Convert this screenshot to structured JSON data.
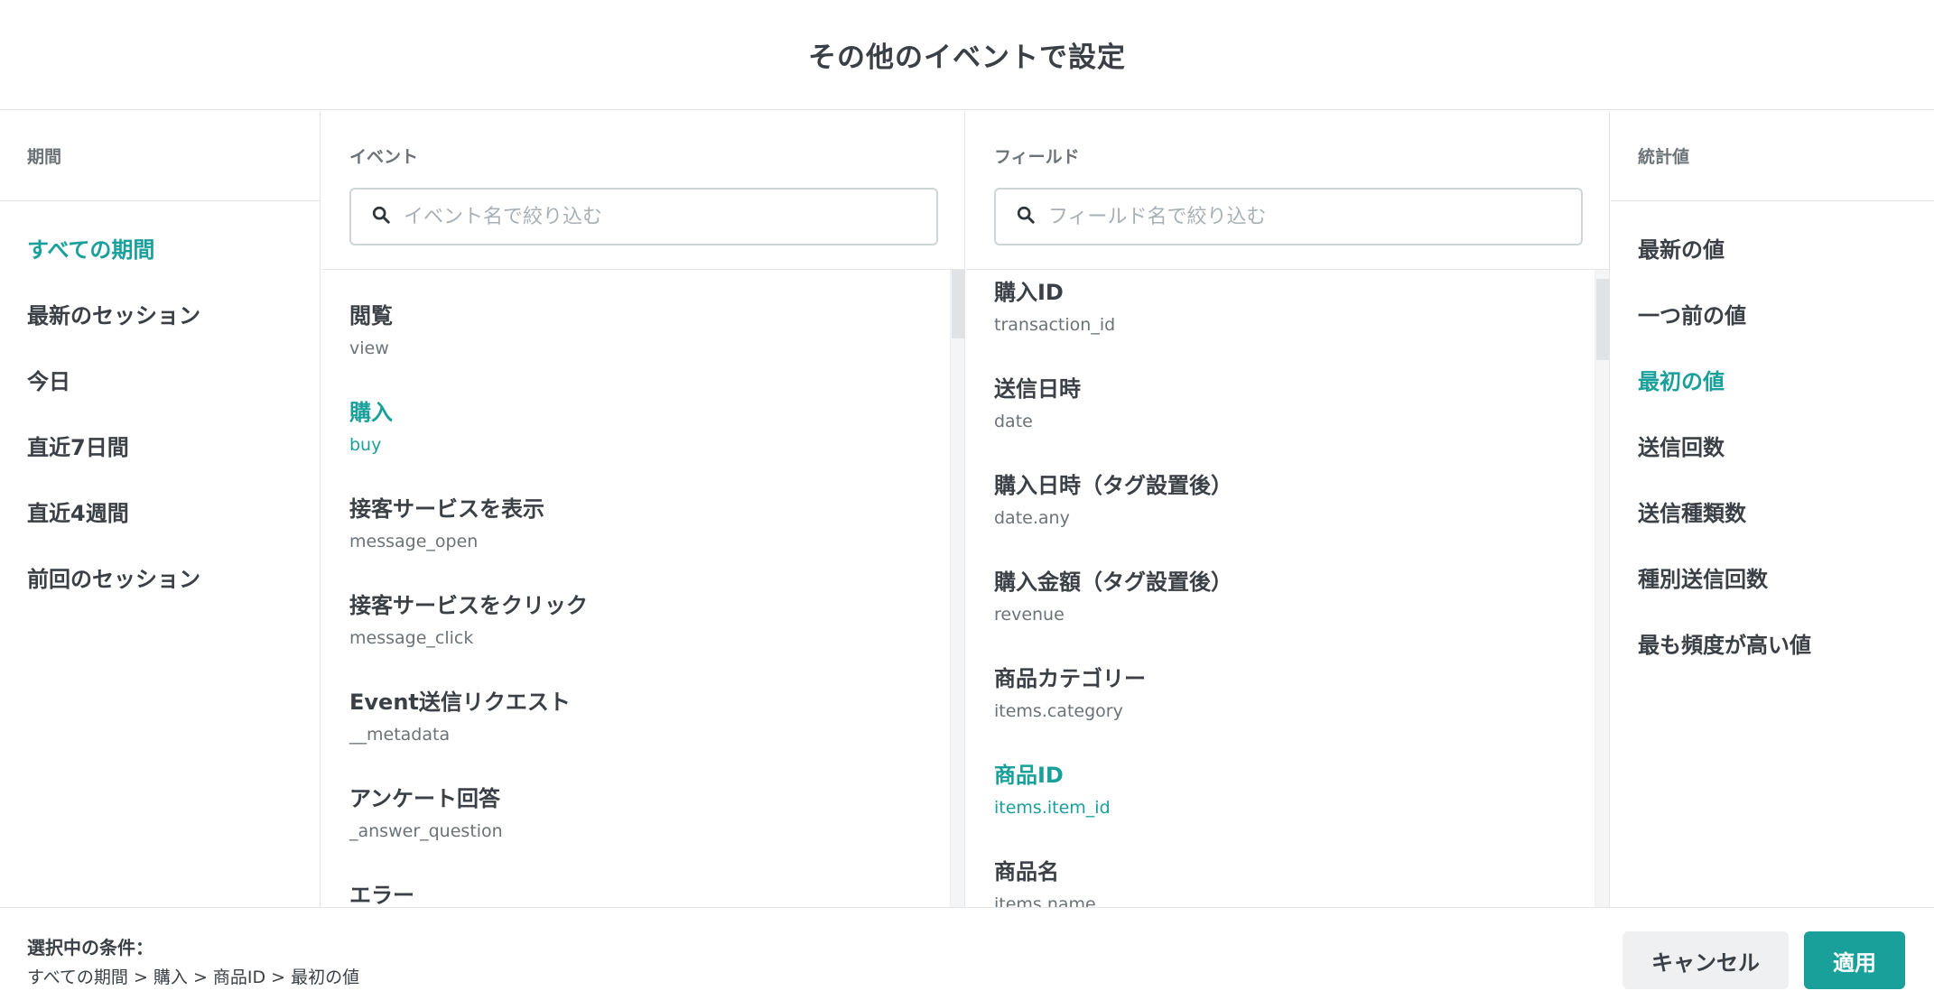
{
  "dialog": {
    "title": "その他のイベントで設定"
  },
  "period": {
    "label": "期間",
    "items": [
      "すべての期間",
      "最新のセッション",
      "今日",
      "直近7日間",
      "直近4週間",
      "前回のセッション"
    ]
  },
  "event": {
    "label": "イベント",
    "search_placeholder": "イベント名で絞り込む",
    "items": [
      {
        "name": "閲覧",
        "key": "view"
      },
      {
        "name": "購入",
        "key": "buy"
      },
      {
        "name": "接客サービスを表示",
        "key": "message_open"
      },
      {
        "name": "接客サービスをクリック",
        "key": "message_click"
      },
      {
        "name": "Event送信リクエスト",
        "key": "__metadata"
      },
      {
        "name": "アンケート回答",
        "key": "_answer_question"
      },
      {
        "name": "エラー",
        "key": ""
      }
    ]
  },
  "field": {
    "label": "フィールド",
    "search_placeholder": "フィールド名で絞り込む",
    "items": [
      {
        "name": "購入ID",
        "key": "transaction_id"
      },
      {
        "name": "送信日時",
        "key": "date"
      },
      {
        "name": "購入日時（タグ設置後）",
        "key": "date.any"
      },
      {
        "name": "購入金額（タグ設置後）",
        "key": "revenue"
      },
      {
        "name": "商品カテゴリー",
        "key": "items.category"
      },
      {
        "name": "商品ID",
        "key": "items.item_id"
      },
      {
        "name": "商品名",
        "key": "items.name"
      }
    ]
  },
  "stat": {
    "label": "統計値",
    "items": [
      "最新の値",
      "一つ前の値",
      "最初の値",
      "送信回数",
      "送信種類数",
      "種別送信回数",
      "最も頻度が高い値"
    ]
  },
  "footer": {
    "selected_label": "選択中の条件：",
    "selected_path": "すべての期間 > 購入 > 商品ID > 最初の値",
    "cancel": "キャンセル",
    "apply": "適用"
  },
  "colors": {
    "accent": "#1aa09b",
    "text": "#3a4045",
    "muted": "#6b7378",
    "border": "#e3e6e8"
  },
  "icons": {
    "search": "search-icon"
  }
}
